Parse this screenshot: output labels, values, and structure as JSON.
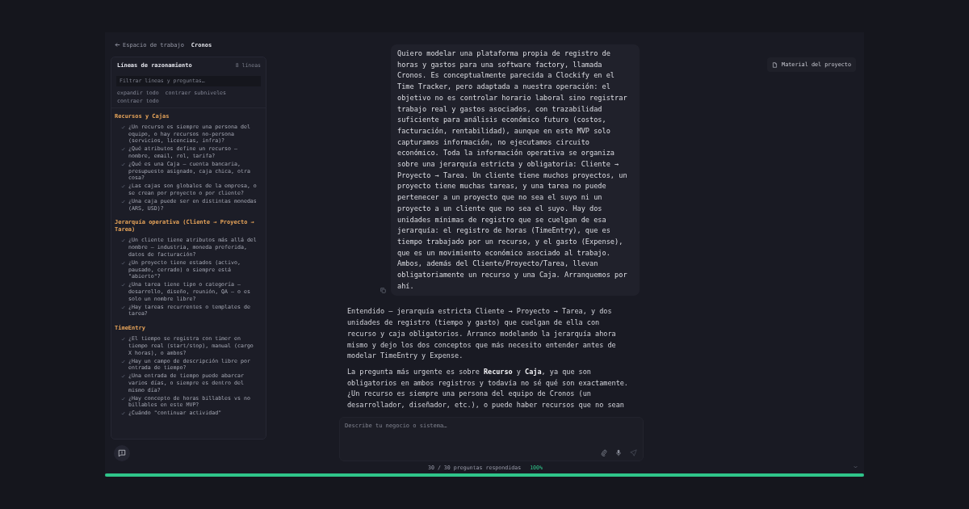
{
  "breadcrumb": {
    "back": "Espacio de trabajo",
    "current": "Cronos"
  },
  "sidebar": {
    "title": "Líneas de razonamiento",
    "count": "8 líneas",
    "search": {
      "placeholder": "Filtrar líneas y preguntas…"
    },
    "actions": [
      "expandir todo",
      "contraer subniveles",
      "contraer todo"
    ],
    "groups": [
      {
        "title": "Recursos y Cajas",
        "questions": [
          {
            "text": "¿Un recurso es siempre una persona del equipo, o hay recursos no-persona (servicios, licencias, infra)?",
            "answered": true
          },
          {
            "text": "¿Qué atributos define un recurso — nombre, email, rol, tarifa?",
            "answered": true
          },
          {
            "text": "¿Qué es una Caja — cuenta bancaria, presupuesto asignado, caja chica, otra cosa?",
            "answered": true
          },
          {
            "text": "¿Las cajas son globales de la empresa, o se crean por proyecto o por cliente?",
            "answered": true
          },
          {
            "text": "¿Una caja puede ser en distintas monedas (ARS, USD)?",
            "answered": true
          }
        ]
      },
      {
        "title": "Jerarquía operativa (Cliente → Proyecto → Tarea)",
        "questions": [
          {
            "text": "¿Un cliente tiene atributos más allá del nombre — industria, moneda preferida, datos de facturación?",
            "answered": true
          },
          {
            "text": "¿Un proyecto tiene estados (activo, pausado, cerrado) o siempre está \"abierto\"?",
            "answered": true
          },
          {
            "text": "¿Una tarea tiene tipo o categoría — desarrollo, diseño, reunión, QA — o es solo un nombre libre?",
            "answered": true
          },
          {
            "text": "¿Hay tareas recurrentes o templates de tarea?",
            "answered": true
          }
        ]
      },
      {
        "title": "TimeEntry",
        "questions": [
          {
            "text": "¿El tiempo se registra con timer en tiempo real (start/stop), manual (cargo X horas), o ambos?",
            "answered": true
          },
          {
            "text": "¿Hay un campo de descripción libre por entrada de tiempo?",
            "answered": true
          },
          {
            "text": "¿Una entrada de tiempo puede abarcar varios días, o siempre es dentro del mismo día?",
            "answered": true
          },
          {
            "text": "¿Hay concepto de horas billables vs no billables en este MVP?",
            "answered": true
          },
          {
            "text": "¿Cuándo \"continuar actividad\"",
            "answered": true
          }
        ]
      }
    ]
  },
  "project_material_button": "Material del proyecto",
  "user_message": {
    "paragraphs": [
      "Quiero modelar una plataforma propia de registro de horas y gastos para una software factory, llamada Cronos. Es conceptualmente parecida a Clockify en el Time Tracker, pero adaptada a nuestra operación: el objetivo no es controlar horario laboral sino registrar trabajo real y gastos asociados, con trazabilidad suficiente para análisis económico futuro (costos, facturación, rentabilidad), aunque en este MVP solo capturamos información, no ejecutamos circuito económico. Toda la información operativa se organiza sobre una jerarquía estricta y obligatoria: Cliente → Proyecto → Tarea. Un cliente tiene muchos proyectos, un proyecto tiene muchas tareas, y una tarea no puede pertenecer a un proyecto que no sea el suyo ni un proyecto a un cliente que no sea el suyo. Hay dos unidades mínimas de registro que se cuelgan de esa jerarquía: el registro de horas (TimeEntry), que es tiempo trabajado por un recurso, y el gasto (Expense), que es un movimiento económico asociado al trabajo. Ambos, además del Cliente/Proyecto/Tarea, llevan obligatoriamente un recurso y una Caja. Arranquemos por ahí."
    ]
  },
  "assistant_reply": {
    "paragraphs": [
      "Entendido — jerarquía estricta Cliente → Proyecto → Tarea, y dos unidades de registro (tiempo y gasto) que cuelgan de ella con recurso y caja obligatorios. Arranco modelando la jerarquía ahora mismo y dejo los dos conceptos que más necesito entender antes de modelar TimeEntry y Expense.",
      "La pregunta más urgente es sobre **Recurso** y **Caja**, ya que son obligatorios en ambos registros y todavía no sé qué son exactamente. ¿Un recurso es siempre una persona del equipo de Cronos (un desarrollador, diseñador, etc.), o puede haber recursos que no sean"
    ]
  },
  "composer": {
    "placeholder": "Describe tu negocio o sistema…"
  },
  "progress": {
    "label": "30 / 30 preguntas respondidas",
    "percent": "100%",
    "level": 1
  }
}
